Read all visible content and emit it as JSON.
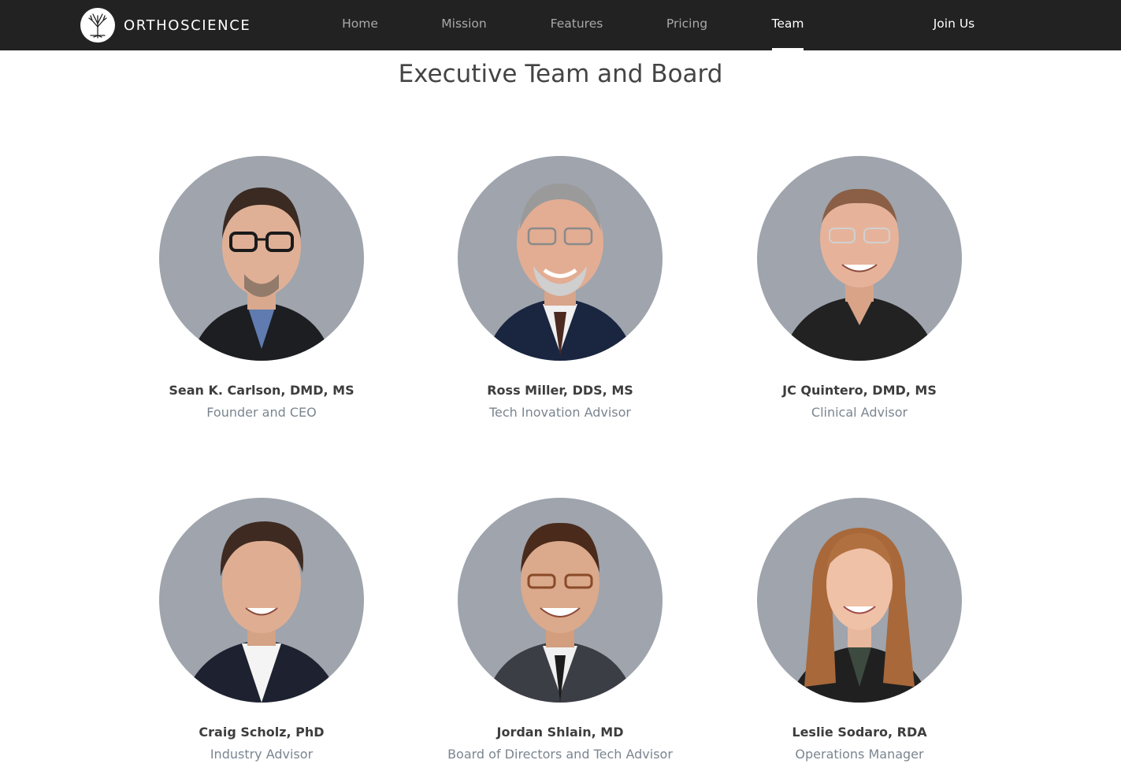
{
  "brand": {
    "name": "ORTHOSCIENCE",
    "logo_icon": "tree-logo-icon"
  },
  "nav": {
    "links": [
      {
        "label": "Home",
        "active": false
      },
      {
        "label": "Mission",
        "active": false
      },
      {
        "label": "Features",
        "active": false
      },
      {
        "label": "Pricing",
        "active": false
      },
      {
        "label": "Team",
        "active": true
      }
    ],
    "join_label": "Join Us"
  },
  "colors": {
    "navbar_bg": "#222222",
    "photo_bg": "#9fa4ad",
    "role_text": "#7b8590"
  },
  "page": {
    "title": "Executive Team and Board"
  },
  "members": [
    {
      "name": "Sean K. Carlson, DMD, MS",
      "role": "Founder and CEO"
    },
    {
      "name": "Ross Miller, DDS, MS",
      "role": "Tech Inovation Advisor"
    },
    {
      "name": "JC Quintero, DMD, MS",
      "role": "Clinical Advisor"
    },
    {
      "name": "Craig Scholz, PhD",
      "role": "Industry Advisor"
    },
    {
      "name": "Jordan Shlain, MD",
      "role": "Board of Directors and Tech Advisor"
    },
    {
      "name": "Leslie Sodaro, RDA",
      "role": "Operations Manager"
    }
  ]
}
